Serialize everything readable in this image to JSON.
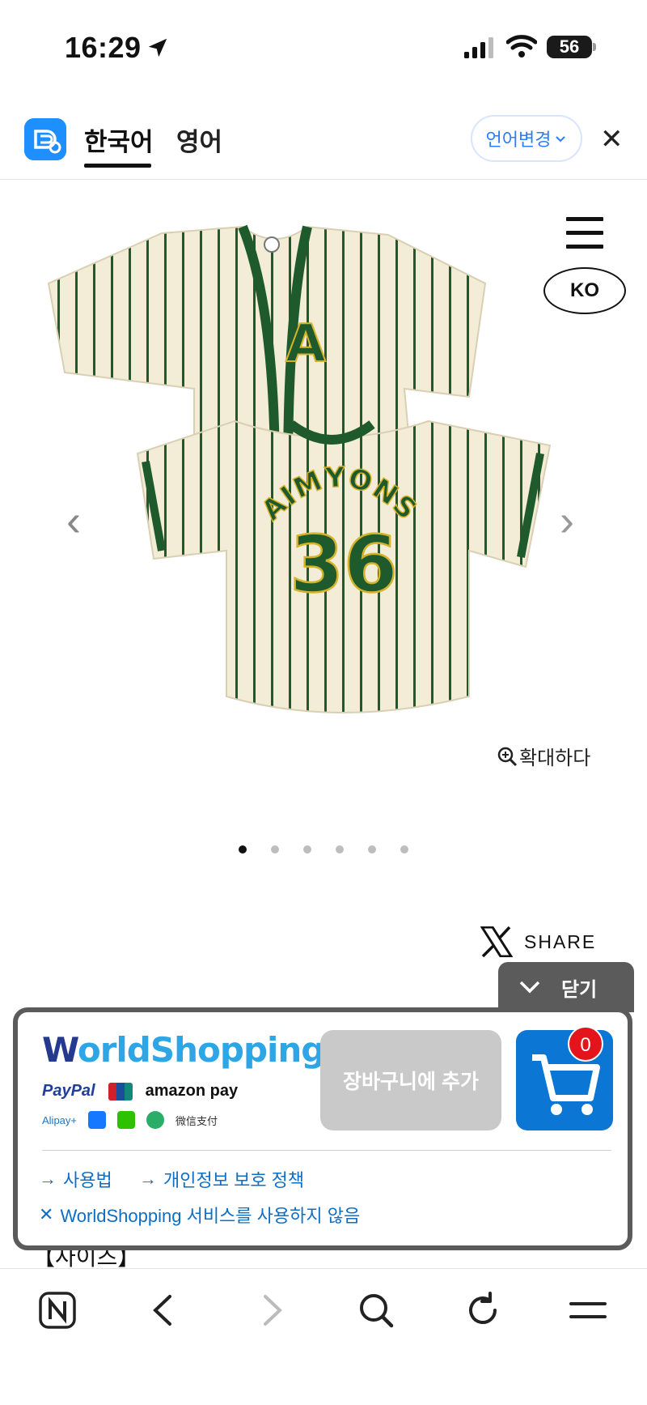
{
  "status_bar": {
    "time": "16:29",
    "battery": "56"
  },
  "translate_bar": {
    "tabs": [
      {
        "label": "한국어",
        "active": true
      },
      {
        "label": "영어",
        "active": false
      }
    ],
    "lang_change_label": "언어변경",
    "close_glyph": "✕"
  },
  "product": {
    "language_badge": "KO",
    "zoom_label": "확대하다",
    "jersey_front_letter": "A",
    "jersey_back_name": "AIMYONS",
    "jersey_back_number": "36",
    "image_count": 6,
    "active_image": 0,
    "share_label": "SHARE"
  },
  "worldshopping": {
    "close_label": "닫기",
    "logo_w": "W",
    "logo_rest": "orldShopping",
    "pay_paypal": "PayPal",
    "pay_amazon": "amazon pay",
    "pay_alipay": "Alipay+",
    "pay_wechat": "微信支付",
    "add_to_cart_label": "장바구니에 추가",
    "cart_count": "0",
    "links": {
      "how_to": "사용법",
      "privacy": "개인정보 보호 정책",
      "disable": "WorldShopping 서비스를 사용하지 않음"
    }
  },
  "page_peek_text": "【사이즈】",
  "colors": {
    "accent_blue": "#0b76d4",
    "link_blue": "#0f6ec2",
    "jersey_green": "#1f5a2c",
    "jersey_cream": "#f3ecd6",
    "badge_red": "#e3141b"
  }
}
